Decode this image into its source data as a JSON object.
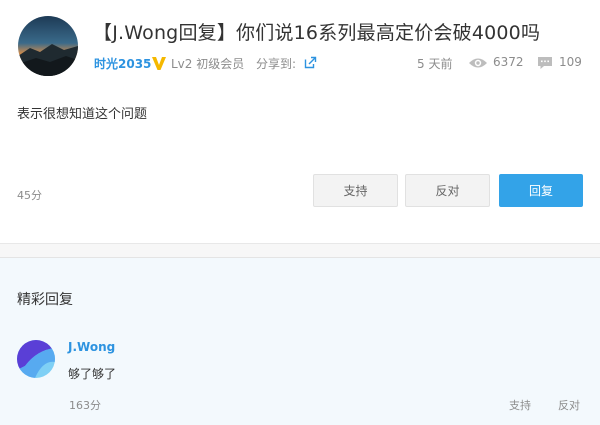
{
  "post": {
    "title": "【J.Wong回复】你们说16系列最高定价会破4000吗",
    "author": "时光2035",
    "level": "Lv2 初级会员",
    "share_label": "分享到:",
    "time": "5 天前",
    "views": "6372",
    "comments": "109",
    "body": "表示很想知道这个问题",
    "score": "45分",
    "buttons": {
      "support": "支持",
      "oppose": "反对",
      "reply": "回复"
    }
  },
  "replies_section": {
    "title": "精彩回复",
    "items": [
      {
        "author": "J.Wong",
        "text": "够了够了",
        "score": "163分",
        "support": "支持",
        "oppose": "反对"
      }
    ]
  },
  "colors": {
    "accent": "#33a3e8",
    "link": "#2d93e0",
    "muted": "#8c8c8c",
    "reply_bg": "#f3f9fd",
    "vip": "#f5b800"
  },
  "icons": {
    "vip": "vip-v-icon",
    "share": "share-icon",
    "views": "eye-icon",
    "comments": "comment-icon"
  }
}
